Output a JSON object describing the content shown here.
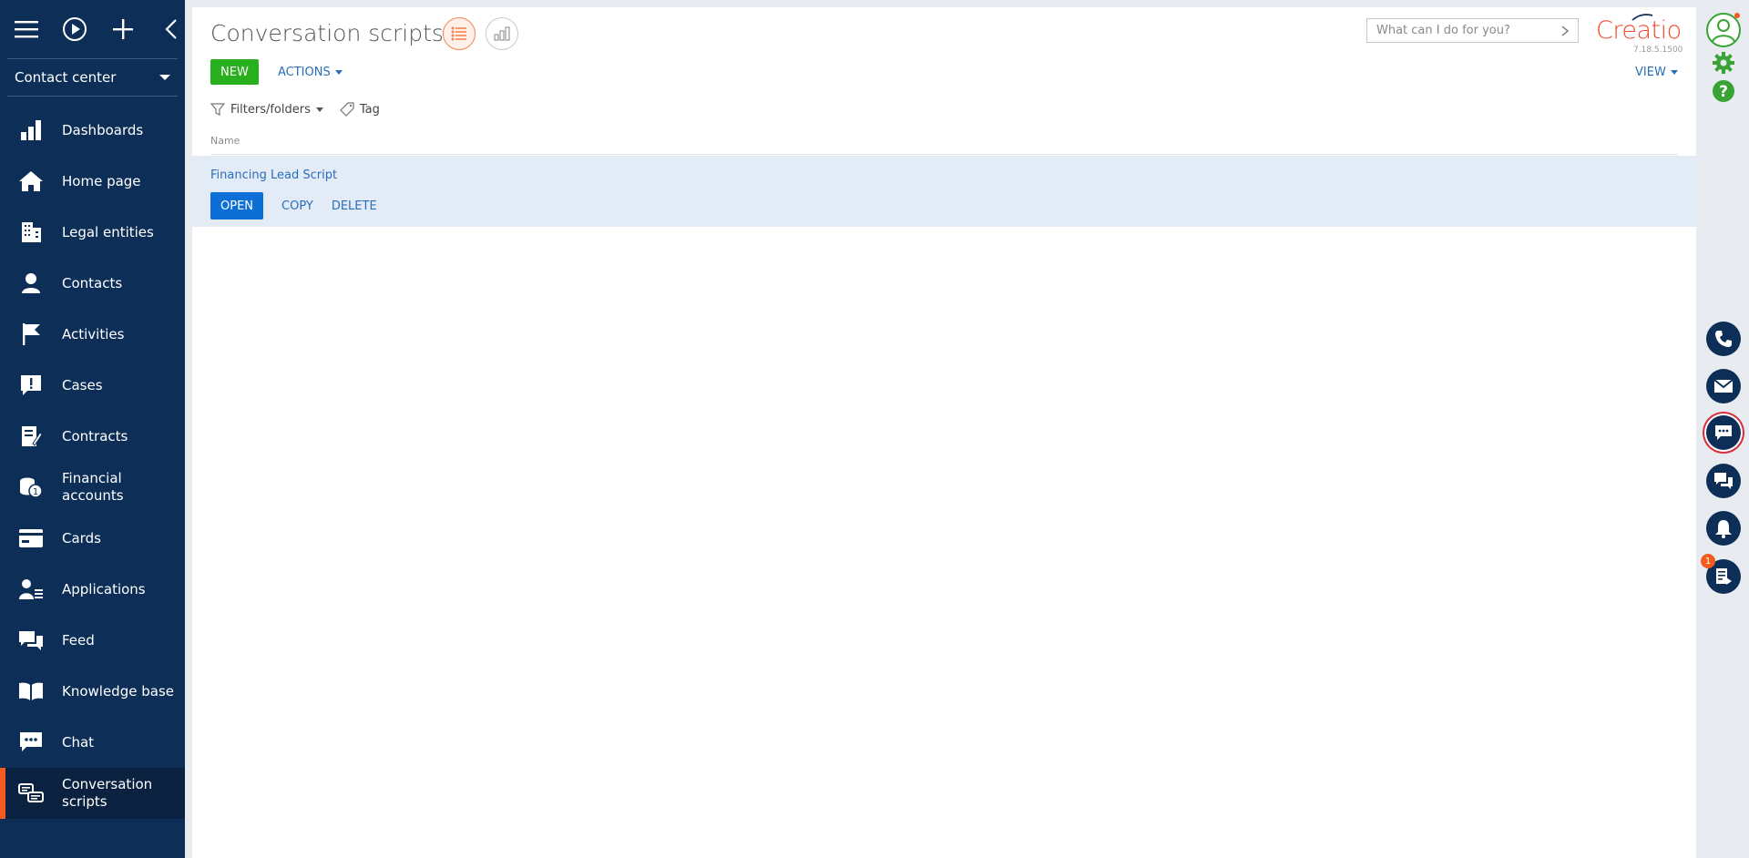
{
  "sidebar": {
    "workspace": "Contact center",
    "items": [
      {
        "label": "Dashboards",
        "icon": "bar-chart-icon"
      },
      {
        "label": "Home page",
        "icon": "home-icon"
      },
      {
        "label": "Legal entities",
        "icon": "building-icon"
      },
      {
        "label": "Contacts",
        "icon": "person-icon"
      },
      {
        "label": "Activities",
        "icon": "flag-icon"
      },
      {
        "label": "Cases",
        "icon": "alert-message-icon"
      },
      {
        "label": "Contracts",
        "icon": "contract-pen-icon"
      },
      {
        "label": "Financial accounts",
        "icon": "coins-icon"
      },
      {
        "label": "Cards",
        "icon": "credit-card-icon"
      },
      {
        "label": "Applications",
        "icon": "applicant-icon"
      },
      {
        "label": "Feed",
        "icon": "feed-chat-icon"
      },
      {
        "label": "Knowledge base",
        "icon": "book-icon"
      },
      {
        "label": "Chat",
        "icon": "chat-bubble-icon"
      },
      {
        "label": "Conversation scripts",
        "icon": "script-icon",
        "active": true
      }
    ]
  },
  "header": {
    "title": "Conversation scripts",
    "search_placeholder": "What can I do for you?",
    "logo": "Creatio",
    "version": "7.18.5.1500"
  },
  "toolbar": {
    "new_label": "NEW",
    "actions_label": "ACTIONS",
    "view_label": "VIEW"
  },
  "filters": {
    "folders_label": "Filters/folders",
    "tag_label": "Tag"
  },
  "grid": {
    "column_name": "Name",
    "rows": [
      {
        "name": "Financing Lead Script"
      }
    ],
    "row_actions": {
      "open": "OPEN",
      "copy": "COPY",
      "delete": "DELETE"
    }
  },
  "right_panel": {
    "notification_count": "1"
  },
  "colors": {
    "sidebar_bg": "#0d2f57",
    "accent_orange": "#f25c21",
    "new_button": "#28b01e",
    "open_button": "#0b6fd6",
    "link_blue": "#2a6ebb",
    "selected_row": "#e3ebf6"
  }
}
